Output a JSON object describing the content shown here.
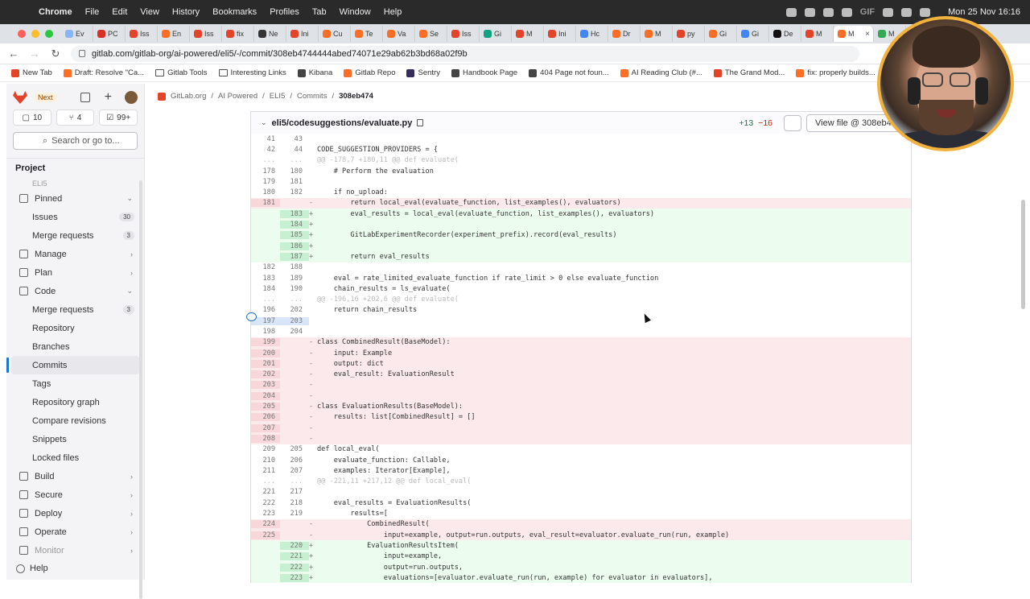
{
  "menubar": {
    "app": "Chrome",
    "items": [
      "File",
      "Edit",
      "View",
      "History",
      "Bookmarks",
      "Profiles",
      "Tab",
      "Window",
      "Help"
    ],
    "status_text": "GIF",
    "clock": "Mon 25 Nov  16:16"
  },
  "tabs": [
    {
      "label": "Ev",
      "color": "#8ab4f8"
    },
    {
      "label": "PC",
      "color": "#d93025"
    },
    {
      "label": "Iss",
      "color": "#e24329"
    },
    {
      "label": "En",
      "color": "#fc6d26"
    },
    {
      "label": "Iss",
      "color": "#e24329"
    },
    {
      "label": "fix",
      "color": "#e24329"
    },
    {
      "label": "Ne",
      "color": "#333333"
    },
    {
      "label": "Ini",
      "color": "#e24329"
    },
    {
      "label": "Cu",
      "color": "#fc6d26"
    },
    {
      "label": "Te",
      "color": "#fc6d26"
    },
    {
      "label": "Va",
      "color": "#fc6d26"
    },
    {
      "label": "Se",
      "color": "#fc6d26"
    },
    {
      "label": "Iss",
      "color": "#e24329"
    },
    {
      "label": "Gi",
      "color": "#10a37f"
    },
    {
      "label": "M",
      "color": "#e24329"
    },
    {
      "label": "Ini",
      "color": "#e24329"
    },
    {
      "label": "Hc",
      "color": "#4285f4"
    },
    {
      "label": "Dr",
      "color": "#fc6d26"
    },
    {
      "label": "M",
      "color": "#fc6d26"
    },
    {
      "label": "py",
      "color": "#e24329"
    },
    {
      "label": "Gi",
      "color": "#fc6d26"
    },
    {
      "label": "Gi",
      "color": "#4285f4"
    },
    {
      "label": "De",
      "color": "#111111"
    },
    {
      "label": "M",
      "color": "#e24329"
    },
    {
      "label": "M",
      "color": "#fc6d26",
      "active": true
    },
    {
      "label": "M",
      "color": "#34a853"
    }
  ],
  "address": {
    "url": "gitlab.com/gitlab-org/ai-powered/eli5/-/commit/308eb4744444abed74071e29ab62b3bd68a02f9b"
  },
  "bookmarks": [
    {
      "label": "New Tab",
      "kind": "fav",
      "color": "#e24329"
    },
    {
      "label": "Draft: Resolve \"Ca...",
      "kind": "fav",
      "color": "#fc6d26"
    },
    {
      "label": "Gitlab Tools",
      "kind": "folder"
    },
    {
      "label": "Interesting Links",
      "kind": "folder"
    },
    {
      "label": "Kibana",
      "kind": "fav",
      "color": "#444444"
    },
    {
      "label": "Gitlab Repo",
      "kind": "fav",
      "color": "#fc6d26"
    },
    {
      "label": "Sentry",
      "kind": "fav",
      "color": "#362d59"
    },
    {
      "label": "Handbook Page",
      "kind": "fav",
      "color": "#444444"
    },
    {
      "label": "404 Page not foun...",
      "kind": "fav",
      "color": "#444444"
    },
    {
      "label": "AI Reading Club (#...",
      "kind": "fav",
      "color": "#fc6d26"
    },
    {
      "label": "The Grand Mod...",
      "kind": "fav",
      "color": "#e24329"
    },
    {
      "label": "fix: properly builds...",
      "kind": "fav",
      "color": "#fc6d26"
    }
  ],
  "sidebar": {
    "badge": "Next",
    "counts": [
      "10",
      "4",
      "99+"
    ],
    "search_placeholder": "Search or go to...",
    "section": "Project",
    "faded_top": "ELI5",
    "items": [
      {
        "label": "Pinned",
        "chevron": "⌄",
        "icon": true
      },
      {
        "label": "Issues",
        "badge": "30",
        "sub": true
      },
      {
        "label": "Merge requests",
        "badge": "3",
        "sub": true
      },
      {
        "label": "Manage",
        "chevron": "›",
        "icon": true
      },
      {
        "label": "Plan",
        "chevron": "›",
        "icon": true
      },
      {
        "label": "Code",
        "chevron": "⌄",
        "icon": true
      },
      {
        "label": "Merge requests",
        "badge": "3",
        "sub": true
      },
      {
        "label": "Repository",
        "sub": true
      },
      {
        "label": "Branches",
        "sub": true
      },
      {
        "label": "Commits",
        "sub": true,
        "active": true
      },
      {
        "label": "Tags",
        "sub": true
      },
      {
        "label": "Repository graph",
        "sub": true
      },
      {
        "label": "Compare revisions",
        "sub": true
      },
      {
        "label": "Snippets",
        "sub": true
      },
      {
        "label": "Locked files",
        "sub": true
      },
      {
        "label": "Build",
        "chevron": "›",
        "icon": true
      },
      {
        "label": "Secure",
        "chevron": "›",
        "icon": true
      },
      {
        "label": "Deploy",
        "chevron": "›",
        "icon": true
      },
      {
        "label": "Operate",
        "chevron": "›",
        "icon": true
      },
      {
        "label": "Monitor",
        "chevron": "›",
        "icon": true,
        "faded": true
      }
    ],
    "help": "Help"
  },
  "breadcrumbs": [
    "GitLab.org",
    "AI Powered",
    "ELI5",
    "Commits",
    "308eb474"
  ],
  "file": {
    "path": "eli5/codesuggestions/evaluate.py",
    "additions": "+13",
    "deletions": "−16",
    "view_button": "View file @ 308eb4"
  },
  "diff": [
    {
      "o": "41",
      "n": "43",
      "m": "",
      "c": "",
      "t": "ctx"
    },
    {
      "o": "42",
      "n": "44",
      "m": "",
      "c": "CODE_SUGGESTION_PROVIDERS = {",
      "t": "ctx"
    },
    {
      "o": "...",
      "n": "...",
      "m": "",
      "c": "@@ -178,7 +180,11 @@ def evaluate(",
      "t": "hunk"
    },
    {
      "o": "178",
      "n": "180",
      "m": "",
      "c": "    # Perform the evaluation",
      "t": "ctx"
    },
    {
      "o": "179",
      "n": "181",
      "m": "",
      "c": "",
      "t": "ctx"
    },
    {
      "o": "180",
      "n": "182",
      "m": "",
      "c": "    if no_upload:",
      "t": "ctx"
    },
    {
      "o": "181",
      "n": "",
      "m": "-",
      "c": "        return local_eval(evaluate_function, list_examples(), evaluators)",
      "t": "del"
    },
    {
      "o": "",
      "n": "183",
      "m": "+",
      "c": "        eval_results = local_eval(evaluate_function, list_examples(), evaluators)",
      "t": "add"
    },
    {
      "o": "",
      "n": "184",
      "m": "+",
      "c": "",
      "t": "add"
    },
    {
      "o": "",
      "n": "185",
      "m": "+",
      "c": "        GitLabExperimentRecorder(experiment_prefix).record(eval_results)",
      "t": "add"
    },
    {
      "o": "",
      "n": "186",
      "m": "+",
      "c": "",
      "t": "add"
    },
    {
      "o": "",
      "n": "187",
      "m": "+",
      "c": "        return eval_results",
      "t": "add"
    },
    {
      "o": "182",
      "n": "188",
      "m": "",
      "c": "",
      "t": "ctx"
    },
    {
      "o": "183",
      "n": "189",
      "m": "",
      "c": "    eval = rate_limited_evaluate_function if rate_limit > 0 else evaluate_function",
      "t": "ctx"
    },
    {
      "o": "184",
      "n": "190",
      "m": "",
      "c": "    chain_results = ls_evaluate(",
      "t": "ctx"
    },
    {
      "o": "...",
      "n": "...",
      "m": "",
      "c": "@@ -196,16 +202,6 @@ def evaluate(",
      "t": "hunk"
    },
    {
      "o": "196",
      "n": "202",
      "m": "",
      "c": "    return chain_results",
      "t": "ctx"
    },
    {
      "o": "197",
      "n": "203",
      "m": "",
      "c": "",
      "t": "hl"
    },
    {
      "o": "198",
      "n": "204",
      "m": "",
      "c": "",
      "t": "ctx"
    },
    {
      "o": "199",
      "n": "",
      "m": "-",
      "c": "class CombinedResult(BaseModel):",
      "t": "del"
    },
    {
      "o": "200",
      "n": "",
      "m": "-",
      "c": "    input: Example",
      "t": "del"
    },
    {
      "o": "201",
      "n": "",
      "m": "-",
      "c": "    output: dict",
      "t": "del"
    },
    {
      "o": "202",
      "n": "",
      "m": "-",
      "c": "    eval_result: EvaluationResult",
      "t": "del"
    },
    {
      "o": "203",
      "n": "",
      "m": "-",
      "c": "",
      "t": "del"
    },
    {
      "o": "204",
      "n": "",
      "m": "-",
      "c": "",
      "t": "del"
    },
    {
      "o": "205",
      "n": "",
      "m": "-",
      "c": "class EvaluationResults(BaseModel):",
      "t": "del"
    },
    {
      "o": "206",
      "n": "",
      "m": "-",
      "c": "    results: list[CombinedResult] = []",
      "t": "del"
    },
    {
      "o": "207",
      "n": "",
      "m": "-",
      "c": "",
      "t": "del"
    },
    {
      "o": "208",
      "n": "",
      "m": "-",
      "c": "",
      "t": "del"
    },
    {
      "o": "209",
      "n": "205",
      "m": "",
      "c": "def local_eval(",
      "t": "ctx"
    },
    {
      "o": "210",
      "n": "206",
      "m": "",
      "c": "    evaluate_function: Callable,",
      "t": "ctx"
    },
    {
      "o": "211",
      "n": "207",
      "m": "",
      "c": "    examples: Iterator[Example],",
      "t": "ctx"
    },
    {
      "o": "...",
      "n": "...",
      "m": "",
      "c": "@@ -221,11 +217,12 @@ def local_eval(",
      "t": "hunk"
    },
    {
      "o": "221",
      "n": "217",
      "m": "",
      "c": "",
      "t": "ctx"
    },
    {
      "o": "222",
      "n": "218",
      "m": "",
      "c": "    eval_results = EvaluationResults(",
      "t": "ctx"
    },
    {
      "o": "223",
      "n": "219",
      "m": "",
      "c": "        results=[",
      "t": "ctx"
    },
    {
      "o": "224",
      "n": "",
      "m": "-",
      "c": "            CombinedResult(",
      "t": "del"
    },
    {
      "o": "225",
      "n": "",
      "m": "-",
      "c": "                input=example, output=run.outputs, eval_result=evaluator.evaluate_run(run, example)",
      "t": "del"
    },
    {
      "o": "",
      "n": "220",
      "m": "+",
      "c": "            EvaluationResultsItem(",
      "t": "add"
    },
    {
      "o": "",
      "n": "221",
      "m": "+",
      "c": "                input=example,",
      "t": "add"
    },
    {
      "o": "",
      "n": "222",
      "m": "+",
      "c": "                output=run.outputs,",
      "t": "add"
    },
    {
      "o": "",
      "n": "223",
      "m": "+",
      "c": "                evaluations=[evaluator.evaluate_run(run, example) for evaluator in evaluators],",
      "t": "add"
    }
  ]
}
